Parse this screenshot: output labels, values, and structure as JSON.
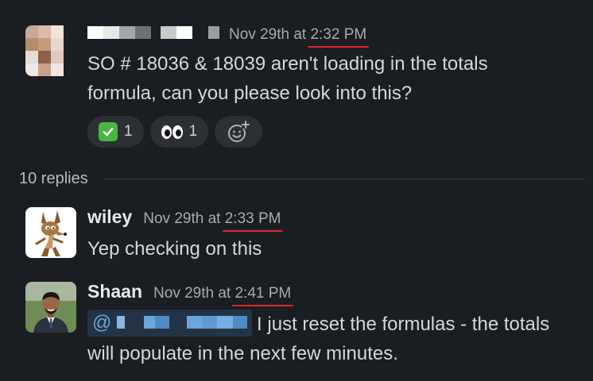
{
  "thread_parent": {
    "timestamp_date": "Nov 29th at",
    "timestamp_time": "2:32 PM",
    "text_line1": "SO # 18036 & 18039 aren't loading in the totals",
    "text_line2": "formula, can you please look into this?",
    "reactions": [
      {
        "emoji": "white-check-mark-icon",
        "count": "1"
      },
      {
        "emoji": "eyes-icon",
        "count": "1"
      }
    ]
  },
  "replies": {
    "label": "10 replies"
  },
  "messages": [
    {
      "name": "wiley",
      "timestamp_date": "Nov 29th at",
      "timestamp_time": "2:33 PM",
      "text": "Yep checking on this",
      "avatar_icon": "coyote-avatar"
    },
    {
      "name": "Shaan",
      "timestamp_date": "Nov 29th at",
      "timestamp_time": "2:41 PM",
      "mention_prefix": "@",
      "text_line1": "I just reset the formulas - the totals",
      "text_line2": "will populate in the next few minutes.",
      "avatar_icon": "person-avatar"
    }
  ],
  "colors": {
    "background": "#1a1d21",
    "underline": "#e0262a",
    "mention": "#6aa6dc"
  }
}
